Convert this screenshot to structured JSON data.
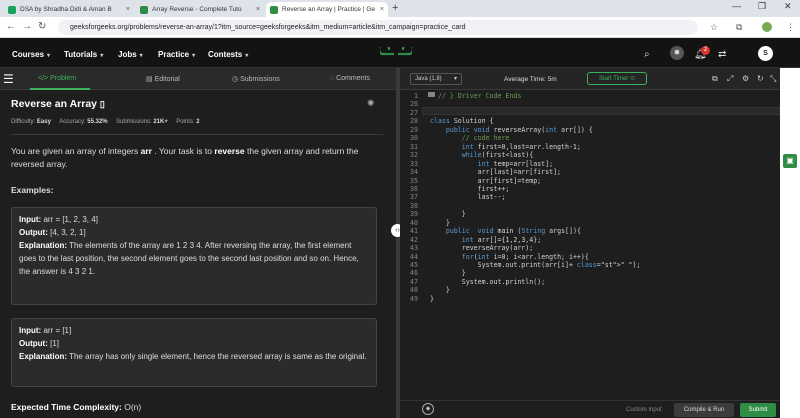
{
  "browser": {
    "tabs": [
      {
        "label": "DSA by Shradha Didi & Aman B",
        "color": "#1aa260"
      },
      {
        "label": "Array Reverse - Complete Tuto",
        "color": "#2f8d46"
      },
      {
        "label": "Reverse an Array | Practice | Ge",
        "color": "#2f8d46"
      }
    ],
    "url": "geeksforgeeks.org/problems/reverse-an-array/1?itm_source=geeksforgeeks&itm_medium=article&itm_campaign=practice_card"
  },
  "gfg": {
    "menu": [
      "Courses",
      "Tutorials",
      "Jobs",
      "Practice",
      "Contests"
    ],
    "notif_count": "2",
    "avatar_letter": "S",
    "logo": "GG"
  },
  "left": {
    "tabs": [
      "</> Problem",
      "Editorial",
      "Submissions",
      "Comments"
    ],
    "title": "Reverse an Array",
    "meta": {
      "difficulty_label": "Difficulty:",
      "difficulty": "Easy",
      "accuracy_label": "Accuracy:",
      "accuracy": "55.32%",
      "submissions_label": "Submissions:",
      "submissions": "21K+",
      "points_label": "Points:",
      "points": "2"
    },
    "desc_a": "You are given an array of integers ",
    "desc_b": "arr",
    "desc_c": " . Your task is to ",
    "desc_d": "reverse",
    "desc_e": " the given array and return the reversed array.",
    "examples_heading": "Examples:",
    "ex1": {
      "input_label": "Input:",
      "input": " arr = [1, 2, 3, 4]",
      "output_label": "Output:",
      "output": " [4, 3, 2, 1]",
      "expl_label": "Explanation:",
      "expl": " The elements of the array are 1 2 3 4. After reversing the array, the first element goes to the last position, the second element goes to the second last position and so on. Hence, the answer is 4 3 2 1."
    },
    "ex2": {
      "input_label": "Input:",
      "input": " arr = [1]",
      "output_label": "Output:",
      "output": " [1]",
      "expl_label": "Explanation:",
      "expl": " The array has only single element, hence the reversed array is same as the original."
    },
    "etc_label": "Expected Time Complexity:",
    "etc": " O(n)"
  },
  "right": {
    "language": "Java (1.8)",
    "avg_time": "Average Time: 5m",
    "start_timer": "Start Timer",
    "custom_input": "Custom Input",
    "compile": "Compile & Run",
    "submit": "Submit",
    "code": [
      {
        "n": "1",
        "t": "  // } Driver Code Ends"
      },
      {
        "n": "26",
        "t": ""
      },
      {
        "n": "27",
        "t": ""
      },
      {
        "n": "28",
        "t": "class Solution {"
      },
      {
        "n": "29",
        "t": "    public void reverseArray(int arr[]) {"
      },
      {
        "n": "30",
        "t": "        // code here"
      },
      {
        "n": "31",
        "t": "        int first=0,last=arr.length-1;"
      },
      {
        "n": "32",
        "t": "        while(first<last){"
      },
      {
        "n": "33",
        "t": "            int temp=arr[last];"
      },
      {
        "n": "34",
        "t": "            arr[last]=arr[first];"
      },
      {
        "n": "35",
        "t": "            arr[first]=temp;"
      },
      {
        "n": "36",
        "t": "            first++;"
      },
      {
        "n": "37",
        "t": "            last--;"
      },
      {
        "n": "38",
        "t": ""
      },
      {
        "n": "39",
        "t": "        }"
      },
      {
        "n": "40",
        "t": "    }"
      },
      {
        "n": "41",
        "t": "    public  void main (String args[]){"
      },
      {
        "n": "42",
        "t": "        int arr[]={1,2,3,4};"
      },
      {
        "n": "43",
        "t": "        reverseArray(arr);"
      },
      {
        "n": "44",
        "t": "        for(int i=0; i<arr.length; i++){"
      },
      {
        "n": "45",
        "t": "            System.out.print(arr[i]+ \" \");"
      },
      {
        "n": "46",
        "t": "        }"
      },
      {
        "n": "47",
        "t": "        System.out.println();"
      },
      {
        "n": "48",
        "t": "    }"
      },
      {
        "n": "49",
        "t": "}"
      }
    ]
  }
}
